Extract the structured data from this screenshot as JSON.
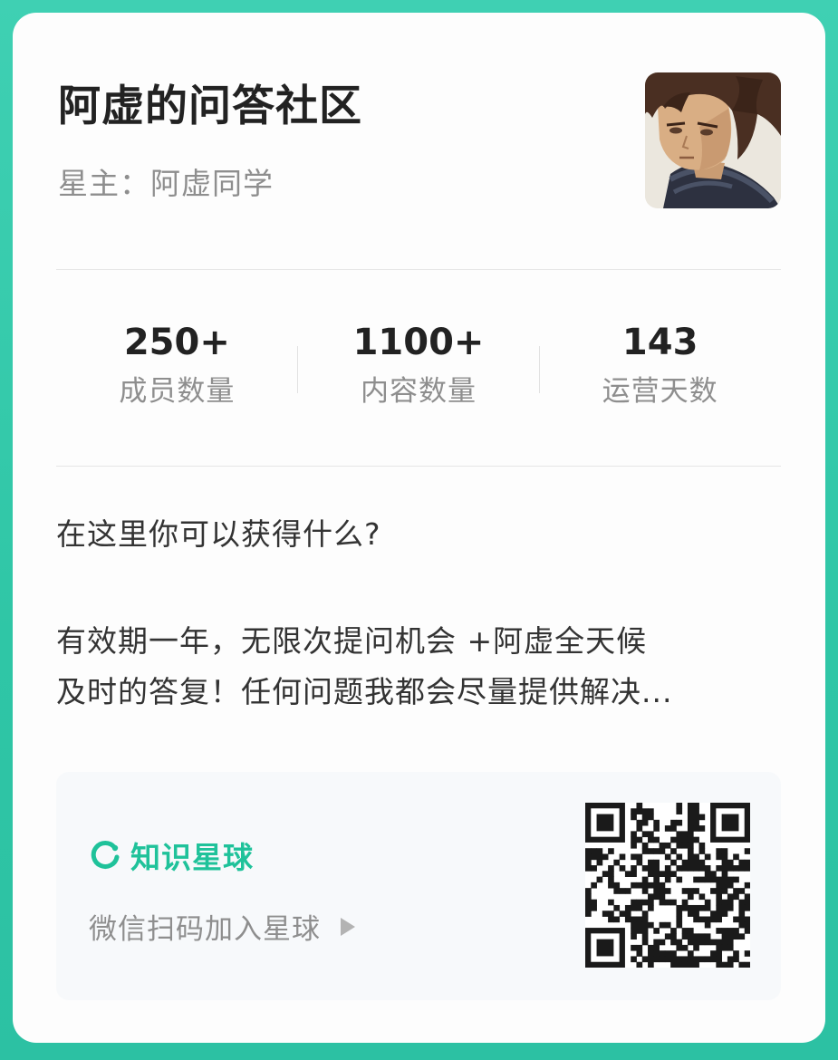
{
  "header": {
    "title": "阿虚的问答社区",
    "owner": "星主：阿虚同学"
  },
  "stats": [
    {
      "value": "250+",
      "label": "成员数量"
    },
    {
      "value": "1100+",
      "label": "内容数量"
    },
    {
      "value": "143",
      "label": "运营天数"
    }
  ],
  "description": {
    "question": "在这里你可以获得什么?",
    "lines": [
      "有效期一年，无限次提问机会 +阿虚全天候",
      "及时的答复！任何问题我都会尽量提供解决..."
    ]
  },
  "join": {
    "brand": "知识星球",
    "action": "微信扫码加入星球",
    "brand_color": "#1fc29a"
  },
  "icons": {
    "brand_logo": "zsxq-logo-icon",
    "arrow": "play-arrow-icon",
    "qr": "qr-code"
  }
}
